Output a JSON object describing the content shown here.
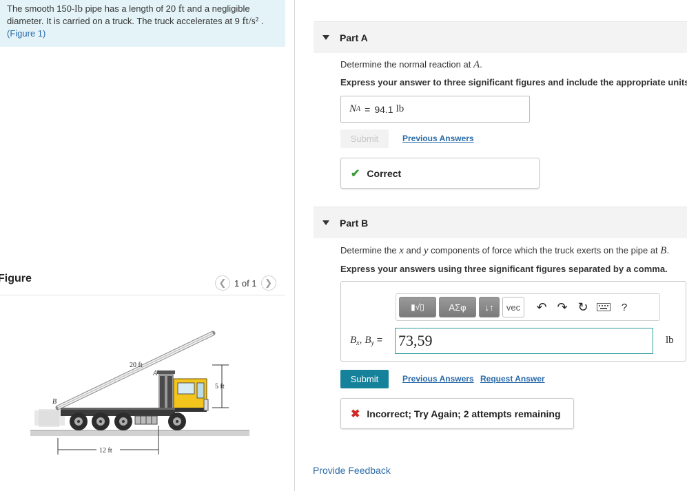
{
  "problem": {
    "text_a": "The smooth 150-",
    "unit_lb": "lb",
    "text_b": " pipe has a length of 20 ",
    "unit_ft": "ft",
    "text_c": " and a negligible diameter. It is carried on a truck. The truck accelerates at 9 ",
    "unit_acc": "ft/s²",
    "text_d": " .",
    "figure_link": "(Figure 1)"
  },
  "figure": {
    "title": "Figure",
    "pager_text": "1 of 1",
    "prev_icon": "chevron-left-icon",
    "next_icon": "chevron-right-icon",
    "labels": {
      "length": "20 ft",
      "height": "5 ft",
      "base": "12 ft",
      "point_a": "A",
      "point_b": "B"
    },
    "colors": {
      "cab": "#f2c41c",
      "bed": "#3a3a3a",
      "pipe": "#e6e6e6",
      "ground": "#d2d2d2"
    }
  },
  "part_a": {
    "title": "Part A",
    "question_prefix": "Determine the normal reaction at ",
    "question_var": "A",
    "question_suffix": ".",
    "instruction": "Express your answer to three significant figures and include the appropriate units.",
    "answer_symbol": "N",
    "answer_sub": "A",
    "answer_eq": "=",
    "answer_value": "94.1",
    "answer_unit": "lb",
    "submit_label": "Submit",
    "previous_answers": "Previous Answers",
    "feedback": "Correct"
  },
  "part_b": {
    "title": "Part B",
    "question_a": "Determine the ",
    "var_x": "x",
    "question_b": " and ",
    "var_y": "y",
    "question_c": " components of force which the truck exerts on the pipe at ",
    "var_b": "B",
    "question_d": ".",
    "instruction": "Express your answers using three significant figures separated by a comma.",
    "toolbar": {
      "templates": "▮√▯",
      "greek": "ΑΣφ",
      "arrows": "↓↑",
      "vec": "vec",
      "undo_icon": "undo-icon",
      "redo_icon": "redo-icon",
      "reset_icon": "reset-icon",
      "keyboard_icon": "keyboard-icon",
      "help": "?"
    },
    "label_b": "B",
    "label_x": "x",
    "label_sep": ", ",
    "label_y": "y",
    "label_eq": " =",
    "input_value": "73,59",
    "unit": "lb",
    "submit_label": "Submit",
    "previous_answers": "Previous Answers",
    "request_answer": "Request Answer",
    "feedback": "Incorrect; Try Again; 2 attempts remaining"
  },
  "provide_feedback": "Provide Feedback",
  "colors": {
    "accent": "#16819a",
    "link": "#2a6aa8",
    "correct": "#3c9a3c",
    "incorrect": "#cf2a27",
    "problem_bg": "#e3f3f7"
  }
}
